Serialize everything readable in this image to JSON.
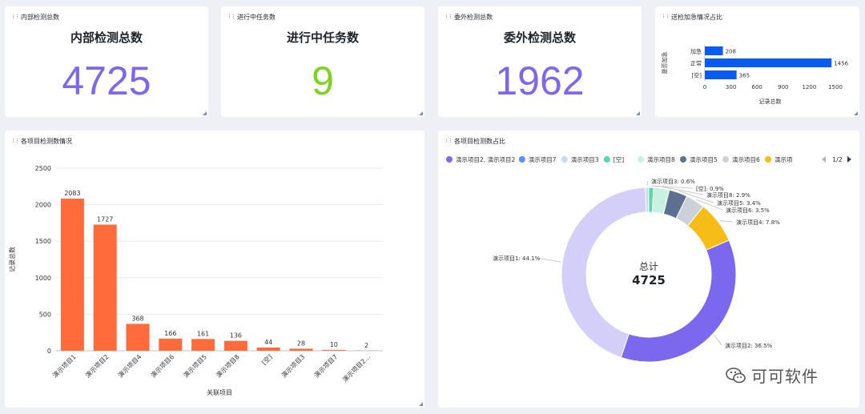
{
  "kpis": {
    "internal": {
      "title": "内部检测总数",
      "label": "内部检测总数",
      "value": "4725",
      "color": "#7b68ee"
    },
    "inprogress": {
      "title": "进行中任务数",
      "label": "进行中任务数",
      "value": "9",
      "color": "#7ed321"
    },
    "external": {
      "title": "委外检测总数",
      "label": "委外检测总数",
      "value": "1962",
      "color": "#7b68ee"
    }
  },
  "urgency": {
    "title": "送检加急情况占比",
    "chart_data": {
      "type": "bar",
      "orientation": "horizontal",
      "categories": [
        "加急",
        "正常",
        "[空]"
      ],
      "values": [
        208,
        1456,
        365
      ],
      "ylabel": "是否加急",
      "xlabel": "记录总数",
      "xlim": [
        0,
        1500
      ],
      "ticks": [
        "0",
        "300",
        "600",
        "900",
        "1200",
        "1500"
      ],
      "color": "#0a5cf0"
    }
  },
  "projects": {
    "title": "各项目检测数情况",
    "chart_data": {
      "type": "bar",
      "categories": [
        "演示项目1",
        "演示项目2",
        "演示项目4",
        "演示项目6",
        "演示项目5",
        "演示项目8",
        "[空]",
        "演示项目3",
        "演示项目7",
        "演示项目2..."
      ],
      "values": [
        2083,
        1727,
        368,
        166,
        161,
        136,
        44,
        28,
        10,
        2
      ],
      "ylabel": "记录总数",
      "xlabel": "关联项目",
      "ylim": [
        0,
        2500
      ],
      "ticks": [
        "0",
        "500",
        "1000",
        "1500",
        "2000",
        "2500"
      ],
      "color": "#ff6b3b",
      "grid": true
    }
  },
  "share": {
    "title": "各项目检测数占比",
    "legend": [
      {
        "name": "演示项目2, 演示项目2",
        "color": "#7b68ee"
      },
      {
        "name": "演示项目7",
        "color": "#5b8ff9"
      },
      {
        "name": "演示项目3",
        "color": "#c8d8f7"
      },
      {
        "name": "[空]",
        "color": "#5ad8a6"
      },
      {
        "name": "演示项目8",
        "color": "#c9f0e0"
      },
      {
        "name": "演示项目5",
        "color": "#5d7092"
      },
      {
        "name": "演示项目6",
        "color": "#ccd0d9"
      },
      {
        "name": "演示项",
        "color": "#f6bd16"
      }
    ],
    "pager": "1/2",
    "center_label": "总计",
    "center_value": "4725",
    "chart_data": {
      "type": "pie",
      "slices": [
        {
          "name": "演示项目2",
          "value": 36.5,
          "label": "演示项目2: 36.5%",
          "color": "#7b68ee"
        },
        {
          "name": "演示项目1",
          "value": 44.1,
          "label": "演示项目1: 44.1%",
          "color": "#d3cff9"
        },
        {
          "name": "演示项目3",
          "value": 0.6,
          "label": "演示项目3: 0.6%",
          "color": "#c8d8f7"
        },
        {
          "name": "[空]",
          "value": 0.9,
          "label": "[空]: 0.9%",
          "color": "#5ad8a6"
        },
        {
          "name": "演示项目8",
          "value": 2.9,
          "label": "演示项目8: 2.9%",
          "color": "#c9f0e0"
        },
        {
          "name": "演示项目5",
          "value": 3.4,
          "label": "演示项目5: 3.4%",
          "color": "#5d7092"
        },
        {
          "name": "演示项目6",
          "value": 3.5,
          "label": "演示项目6: 3.5%",
          "color": "#ccd0d9"
        },
        {
          "name": "演示项目4",
          "value": 7.8,
          "label": "演示项目4: 7.8%",
          "color": "#f6bd16"
        }
      ]
    }
  },
  "brand": {
    "text": "可可软件"
  }
}
